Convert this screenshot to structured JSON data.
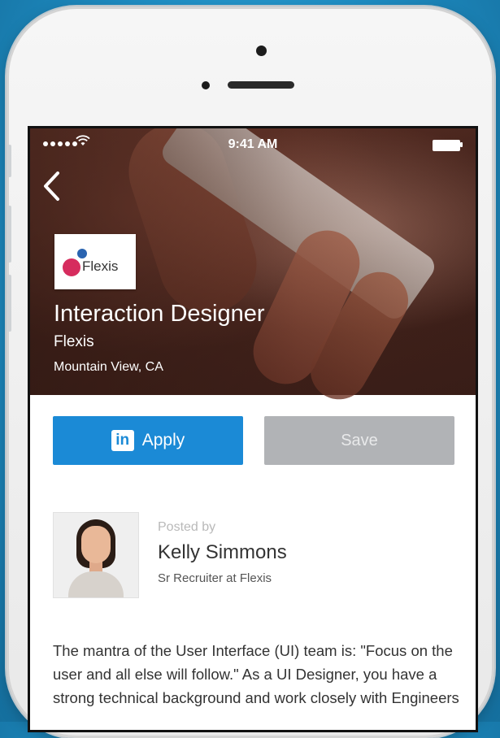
{
  "status_bar": {
    "time": "9:41 AM"
  },
  "job": {
    "company_logo_text": "Flexis",
    "title": "Interaction Designer",
    "company": "Flexis",
    "location": "Mountain View, CA"
  },
  "actions": {
    "apply_icon": "in",
    "apply_label": "Apply",
    "save_label": "Save"
  },
  "poster": {
    "posted_by_label": "Posted by",
    "name": "Kelly Simmons",
    "role": "Sr Recruiter at Flexis"
  },
  "description": "The mantra of the User Interface (UI) team is: \"Focus on the user and all else will follow.\" As a UI Designer, you have a strong technical background and work closely with Engineers",
  "colors": {
    "apply_button": "#1b8ad6",
    "save_button": "#b1b3b6",
    "background": "#1f8ec4"
  },
  "icons": [
    "back-chevron-icon",
    "wifi-icon",
    "battery-icon",
    "linkedin-icon"
  ]
}
